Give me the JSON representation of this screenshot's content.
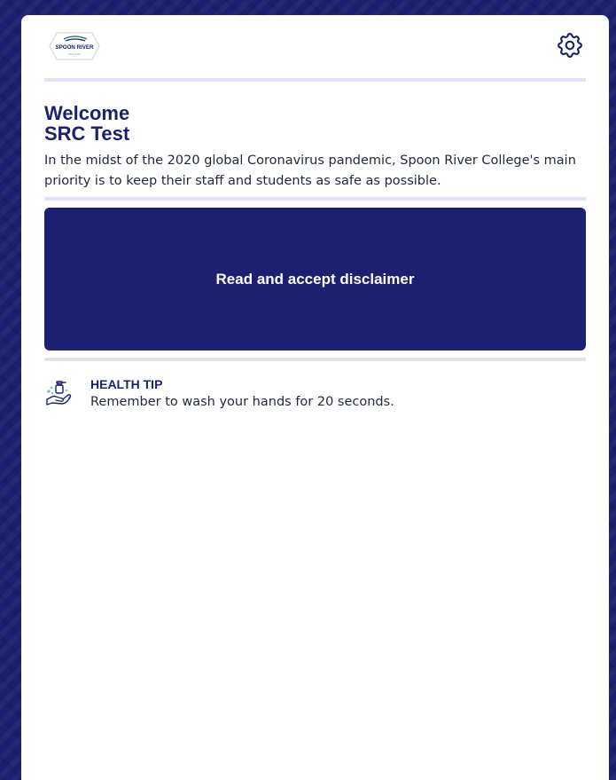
{
  "brand": {
    "logo_text": "SPOON RIVER",
    "logo_subtext": "COLLEGE",
    "primary_color": "#1b2170",
    "divider_color": "#dfe1f5"
  },
  "header": {
    "settings_icon": "gear-icon"
  },
  "welcome": {
    "greeting": "Welcome",
    "user_name": "SRC Test",
    "intro": "In the midst of the 2020 global Coronavirus pandemic, Spoon River College's main priority is to keep their staff and students as safe as possible."
  },
  "disclaimer": {
    "button_label": "Read and accept disclaimer"
  },
  "health_tip": {
    "icon": "hand-wash-icon",
    "title": "HEALTH TIP",
    "text": "Remember to wash your hands for 20 seconds."
  }
}
